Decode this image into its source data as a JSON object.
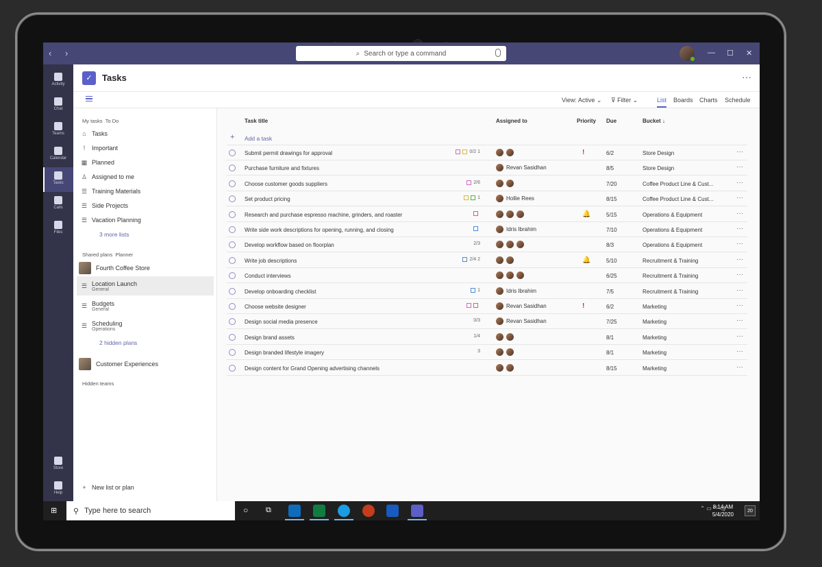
{
  "titlebar": {
    "search_placeholder": "Search or type a command",
    "nav": "‹ ›"
  },
  "rail": [
    {
      "label": "Activity"
    },
    {
      "label": "Chat"
    },
    {
      "label": "Teams"
    },
    {
      "label": "Calendar"
    },
    {
      "label": "Tasks",
      "active": true
    },
    {
      "label": "Calls"
    },
    {
      "label": "Files"
    },
    {
      "label": "Store"
    },
    {
      "label": "Help"
    }
  ],
  "header": {
    "title": "Tasks",
    "more": "···"
  },
  "toolbar": {
    "view": "View: Active",
    "filter": "Filter",
    "tabs": [
      "List",
      "Boards",
      "Charts",
      "Schedule"
    ],
    "active_tab": "List"
  },
  "left_pane": {
    "my_tasks_label": "My tasks",
    "todo_label": "To Do",
    "my_tasks": [
      "Tasks",
      "Important",
      "Planned",
      "Assigned to me",
      "Training Materials",
      "Side Projects",
      "Vacation Planning"
    ],
    "more_lists": "3 more lists",
    "shared_label": "Shared plans",
    "planner_label": "Planner",
    "team1": "Fourth Coffee Store",
    "plans": [
      {
        "name": "Location Launch",
        "sub": "General"
      },
      {
        "name": "Budgets",
        "sub": "General"
      },
      {
        "name": "Scheduling",
        "sub": "Operations"
      }
    ],
    "hidden_plans": "2 hidden plans",
    "team2": "Customer Experiences",
    "hidden_teams": "Hidden teams",
    "new_list": "New list or plan"
  },
  "table": {
    "headers": {
      "title": "Task title",
      "assigned": "Assigned to",
      "priority": "Priority",
      "due": "Due",
      "bucket": "Bucket ↓"
    },
    "add_task": "Add a task",
    "rows": [
      {
        "title": "Submit permit drawings for approval",
        "meta": "0/2  1",
        "assigned": "",
        "priority": "!",
        "due": "6/2",
        "bucket": "Store Design"
      },
      {
        "title": "Purchase furniture and fixtures",
        "meta": "",
        "assigned": "Revan Sasidhan",
        "priority": "",
        "due": "8/5",
        "bucket": "Store Design"
      },
      {
        "title": "Choose customer goods suppliers",
        "meta": "2/6",
        "assigned": "",
        "priority": "",
        "due": "7/20",
        "bucket": "Coffee Product Line & Cust..."
      },
      {
        "title": "Set product pricing",
        "meta": "1",
        "assigned": "Hollie Rees",
        "priority": "",
        "due": "8/15",
        "bucket": "Coffee Product Line & Cust..."
      },
      {
        "title": "Research and purchase espresso machine, grinders, and roaster",
        "meta": "",
        "assigned": "",
        "priority": "🔔",
        "due": "5/15",
        "bucket": "Operations & Equipment"
      },
      {
        "title": "Write side work descriptions for opening, running, and closing",
        "meta": "",
        "assigned": "Idris Ibrahim",
        "priority": "",
        "due": "7/10",
        "bucket": "Operations & Equipment"
      },
      {
        "title": "Develop workflow based on floorplan",
        "meta": "2/3",
        "assigned": "",
        "priority": "",
        "due": "8/3",
        "bucket": "Operations & Equipment"
      },
      {
        "title": "Write job descriptions",
        "meta": "2/4  2",
        "assigned": "",
        "priority": "🔔",
        "due": "5/10",
        "bucket": "Recruitment & Training"
      },
      {
        "title": "Conduct interviews",
        "meta": "",
        "assigned": "",
        "priority": "",
        "due": "6/25",
        "bucket": "Recruitment & Training"
      },
      {
        "title": "Develop onboarding checklist",
        "meta": "1",
        "assigned": "Idris Ibrahim",
        "priority": "",
        "due": "7/5",
        "bucket": "Recruitment & Training"
      },
      {
        "title": "Choose website designer",
        "meta": "",
        "assigned": "Revan Sasidhan",
        "priority": "!",
        "due": "6/2",
        "bucket": "Marketing"
      },
      {
        "title": "Design social media presence",
        "meta": "0/3",
        "assigned": "Revan Sasidhan",
        "priority": "",
        "due": "7/25",
        "bucket": "Marketing"
      },
      {
        "title": "Design brand assets",
        "meta": "1/4",
        "assigned": "",
        "priority": "",
        "due": "8/1",
        "bucket": "Marketing"
      },
      {
        "title": "Design branded lifestyle imagery",
        "meta": "3",
        "assigned": "",
        "priority": "",
        "due": "8/1",
        "bucket": "Marketing"
      },
      {
        "title": "Design content for Grand Opening advertising channels",
        "meta": "",
        "assigned": "",
        "priority": "",
        "due": "8/15",
        "bucket": "Marketing"
      }
    ]
  },
  "taskbar": {
    "search": "Type here to search",
    "time": "8:14 AM",
    "date": "5/4/2020",
    "notif": "20"
  }
}
